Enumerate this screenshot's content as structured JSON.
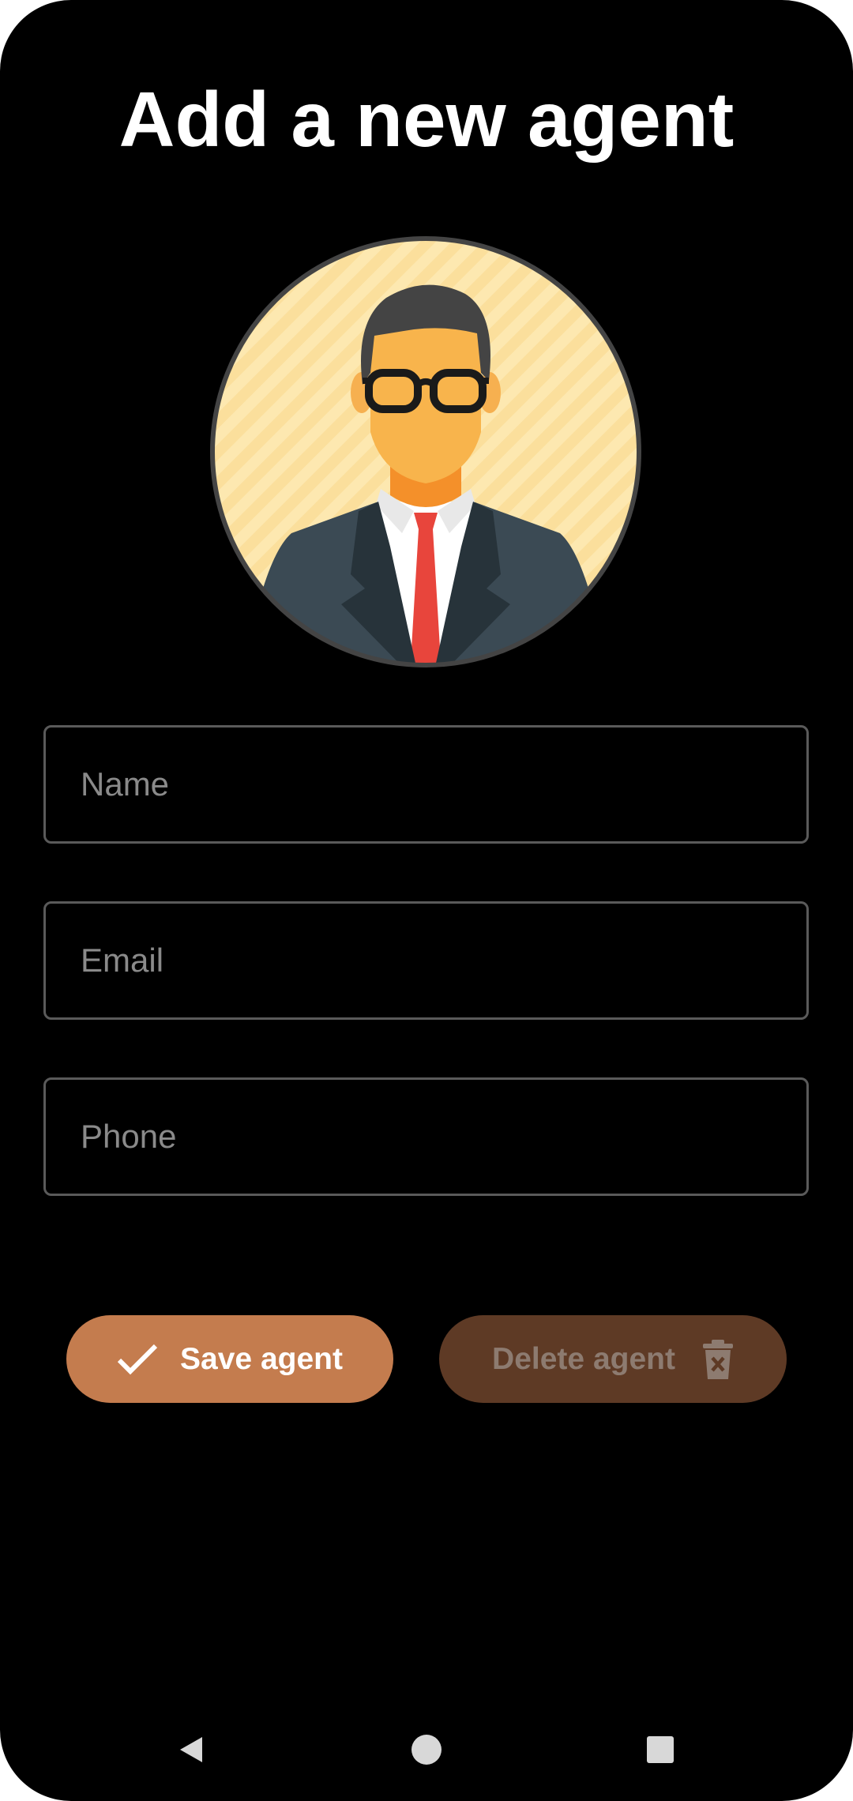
{
  "page": {
    "title": "Add a new agent"
  },
  "form": {
    "name": {
      "value": "",
      "placeholder": "Name"
    },
    "email": {
      "value": "",
      "placeholder": "Email"
    },
    "phone": {
      "value": "",
      "placeholder": "Phone"
    }
  },
  "actions": {
    "save_label": "Save agent",
    "save_icon": "check-icon",
    "delete_label": "Delete agent",
    "delete_icon": "trash-icon",
    "save_color": "#c47c4e",
    "delete_color": "#5e3a25"
  },
  "avatar": {
    "icon": "businessman-avatar-icon",
    "background_color": "#fde8b0"
  },
  "navigation": {
    "back_icon": "back-triangle-icon",
    "home_icon": "home-circle-icon",
    "recents_icon": "recents-square-icon"
  }
}
